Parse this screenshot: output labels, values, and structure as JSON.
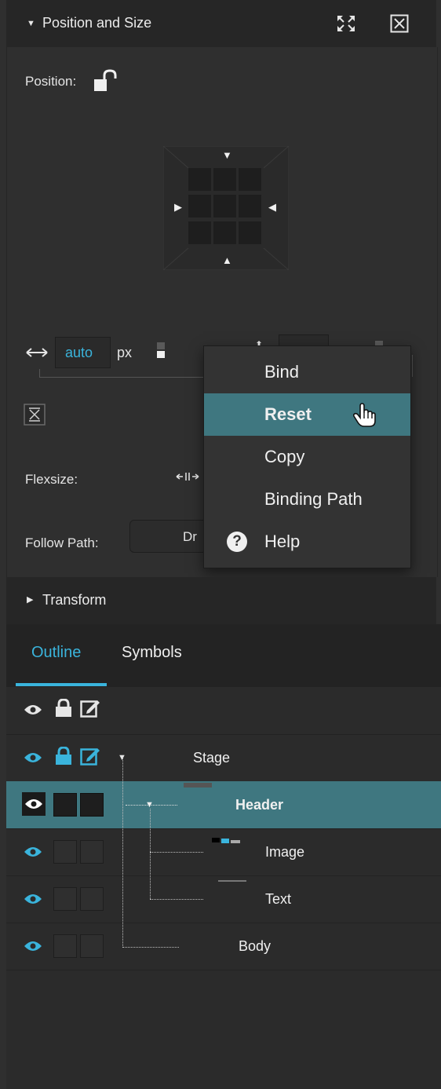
{
  "position_size": {
    "title": "Position and Size",
    "position_label": "Position:",
    "width_value": "auto",
    "width_unit": "px",
    "flexsize_label": "Flexsize:",
    "follow_path_label": "Follow Path:",
    "follow_path_value": "Dr"
  },
  "context_menu": {
    "items": [
      {
        "label": "Bind"
      },
      {
        "label": "Reset"
      },
      {
        "label": "Copy"
      },
      {
        "label": "Binding Path"
      },
      {
        "label": "Help"
      }
    ]
  },
  "transform": {
    "title": "Transform"
  },
  "tabs": {
    "outline": "Outline",
    "symbols": "Symbols"
  },
  "outline": {
    "rows": [
      {
        "name": "Stage"
      },
      {
        "name": "Header"
      },
      {
        "name": "Image"
      },
      {
        "name": "Text"
      },
      {
        "name": "Body"
      }
    ]
  },
  "colors": {
    "accent": "#3ab4dc",
    "selection": "#3f7780"
  }
}
